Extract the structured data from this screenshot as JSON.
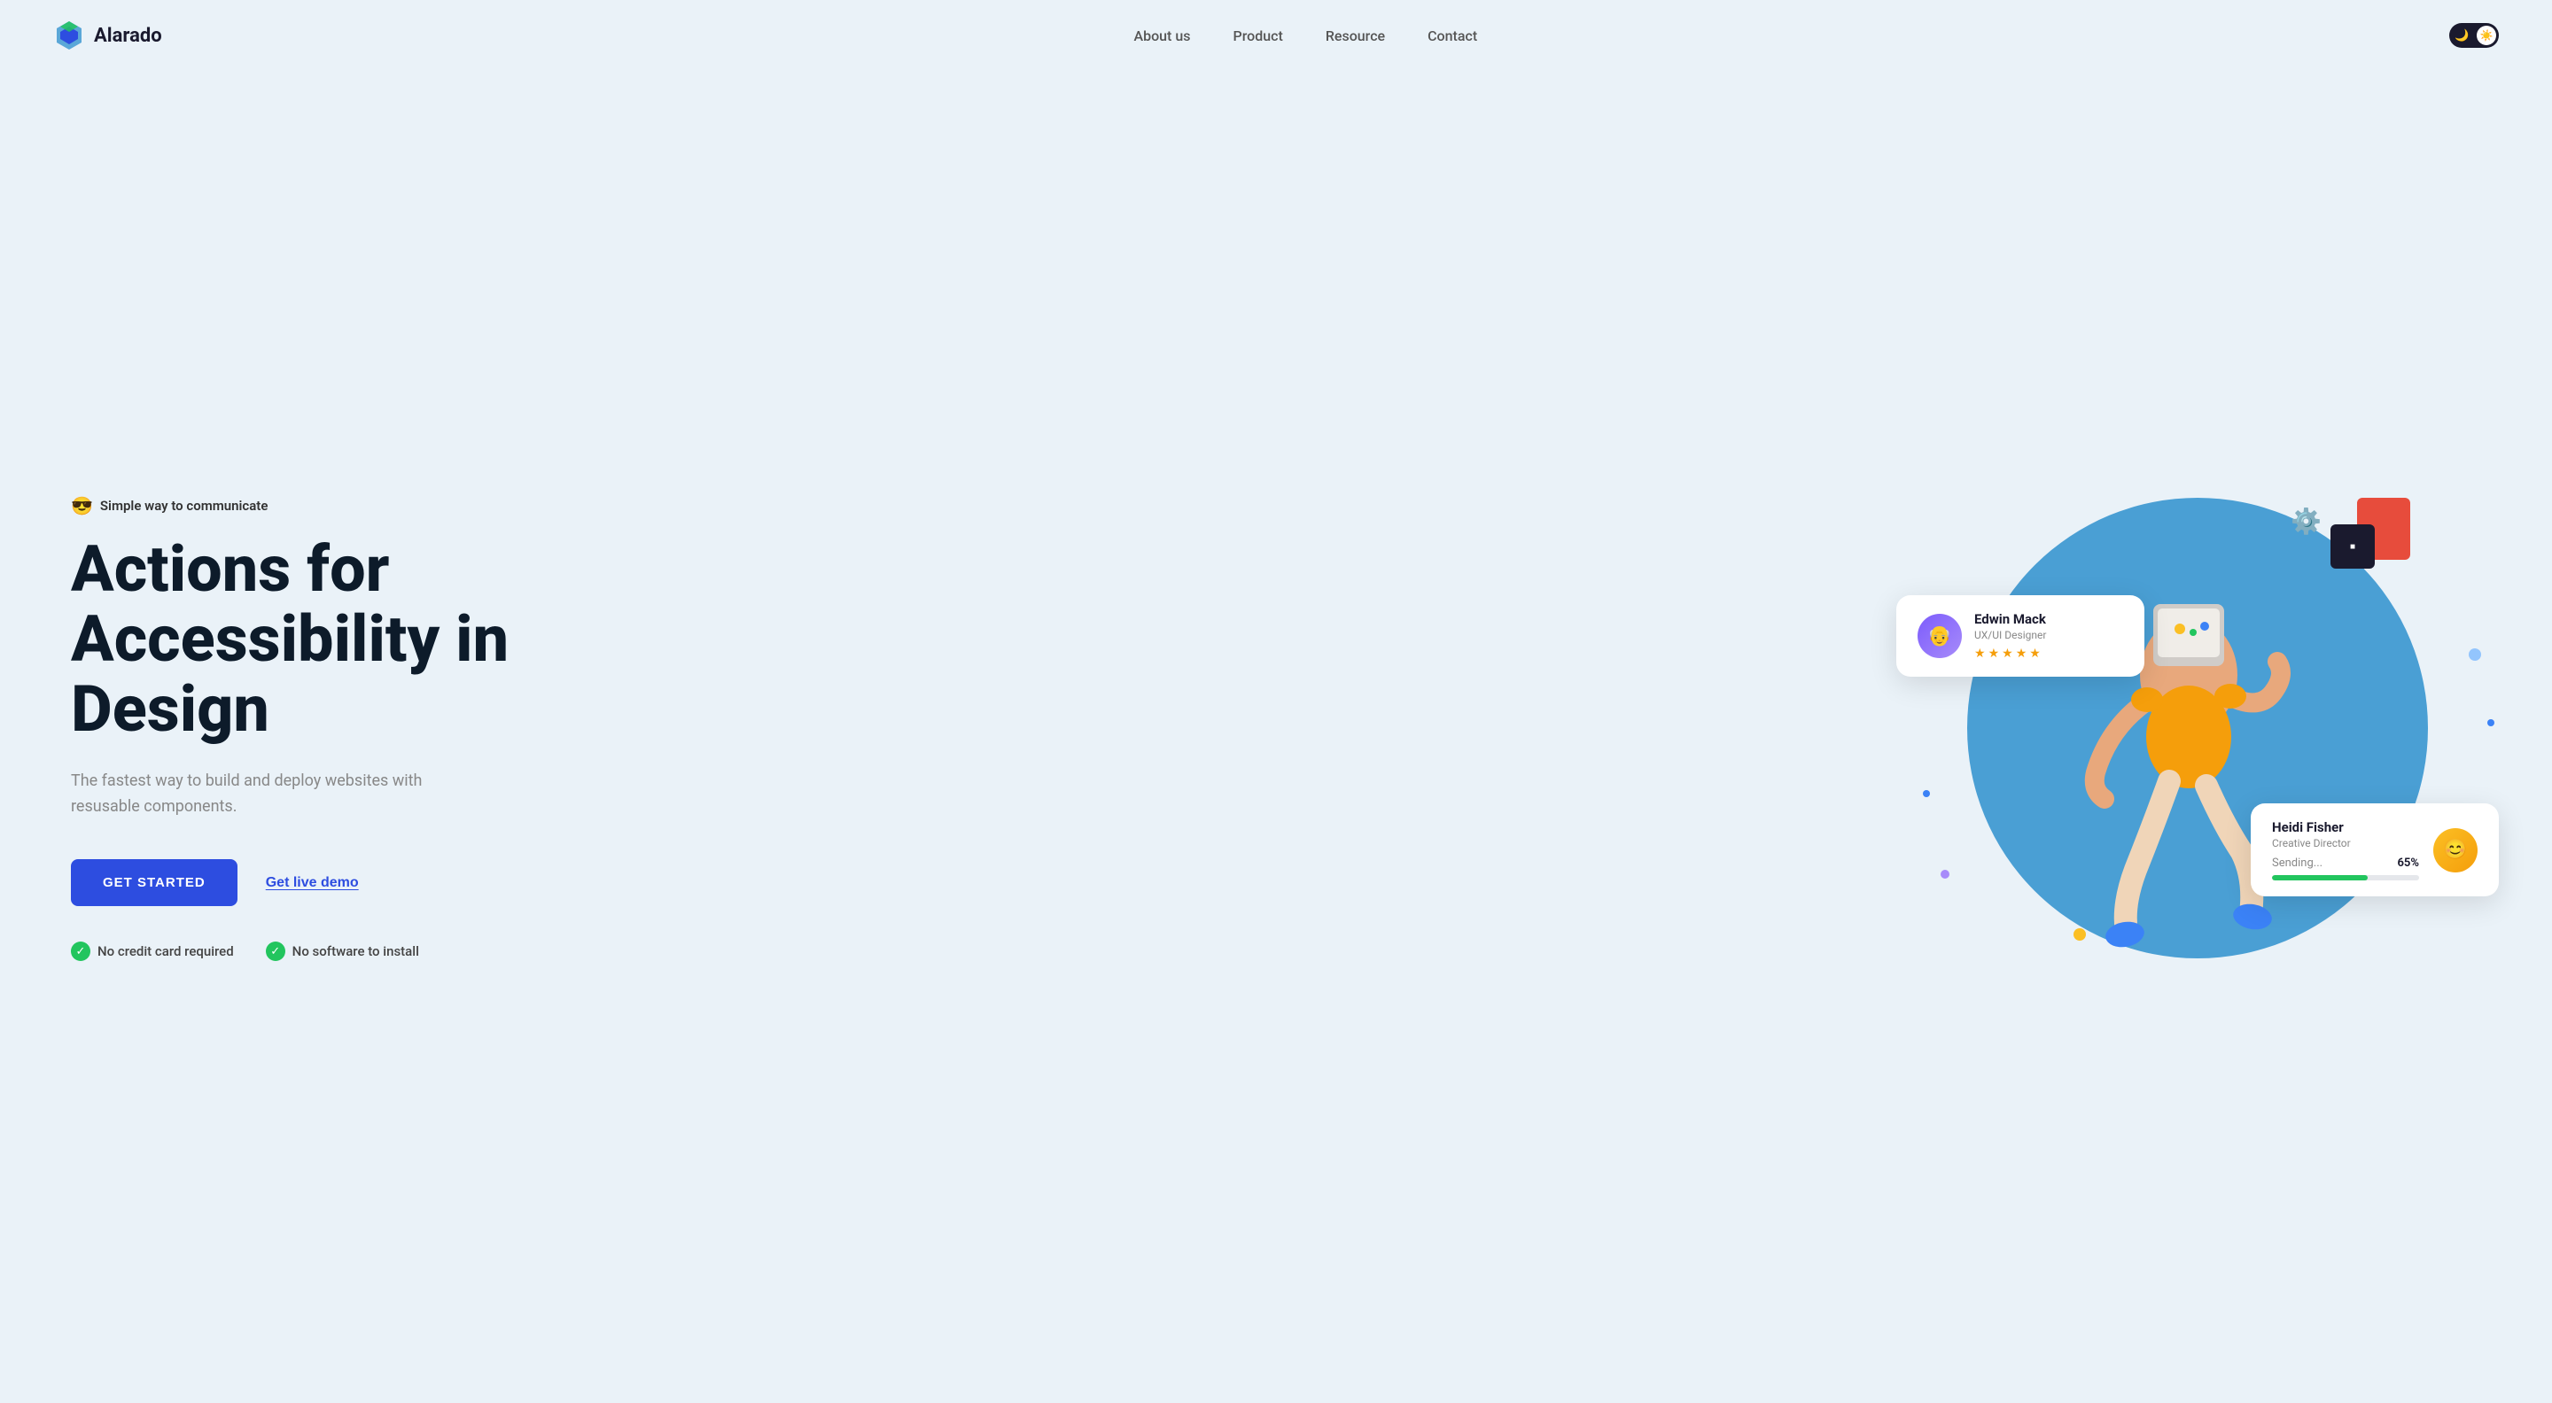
{
  "nav": {
    "logo_text": "Alarado",
    "links": [
      {
        "label": "About us",
        "id": "about"
      },
      {
        "label": "Product",
        "id": "product"
      },
      {
        "label": "Resource",
        "id": "resource"
      },
      {
        "label": "Contact",
        "id": "contact"
      }
    ]
  },
  "hero": {
    "tagline_emoji": "😎",
    "tagline": "Simple way to communicate",
    "title_line1": "Actions for",
    "title_line2": "Accessibility in",
    "title_line3": "Design",
    "subtitle": "The fastest way to build and deploy websites with resusable components.",
    "cta_primary": "GET STARTED",
    "cta_demo": "Get live demo",
    "badge1": "No credit card required",
    "badge2": "No software to install"
  },
  "cards": {
    "edwin": {
      "name": "Edwin Mack",
      "role": "UX/UI Designer",
      "stars": 5
    },
    "heidi": {
      "name": "Heidi Fisher",
      "role": "Creative Director",
      "progress_label": "Sending...",
      "progress_pct": "65%",
      "progress_value": 65
    }
  },
  "colors": {
    "primary": "#2d4de0",
    "accent": "#4a9fd4",
    "green": "#22c55e",
    "star": "#f59e0b"
  }
}
